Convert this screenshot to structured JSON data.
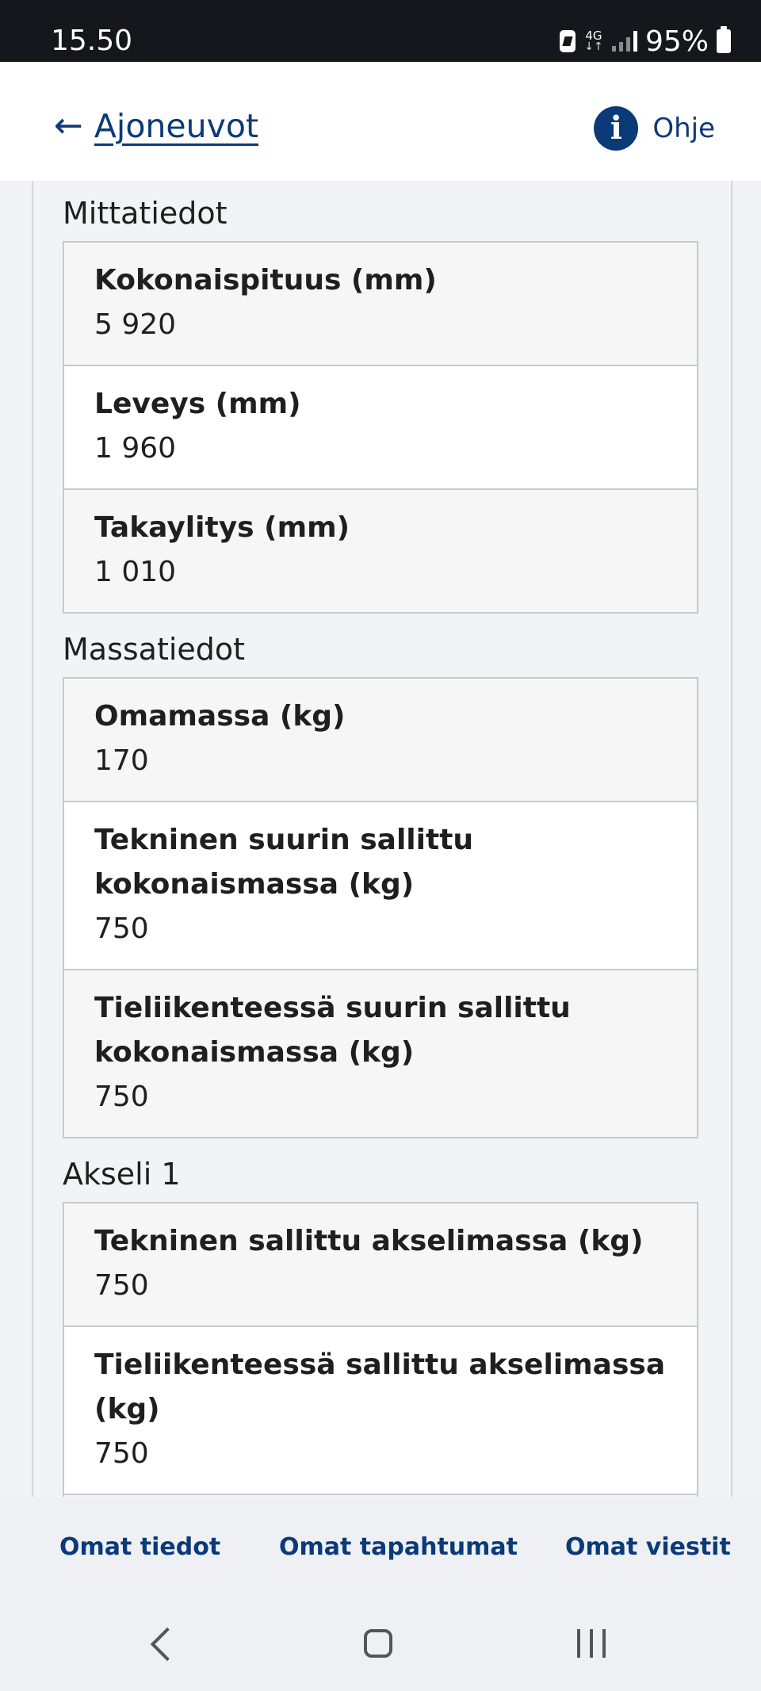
{
  "status_bar": {
    "time": "15.50",
    "network": "4G",
    "battery_percent": "95%"
  },
  "header": {
    "back_label": "Ajoneuvot",
    "help_label": "Ohje",
    "accent_color": "#0b3a78"
  },
  "sections": [
    {
      "title": "Mittatiedot",
      "rows": [
        {
          "label": "Kokonaispituus (mm)",
          "value": "5 920"
        },
        {
          "label": "Leveys (mm)",
          "value": "1 960"
        },
        {
          "label": "Takaylitys (mm)",
          "value": "1 010"
        }
      ]
    },
    {
      "title": "Massatiedot",
      "rows": [
        {
          "label": "Omamassa (kg)",
          "value": "170"
        },
        {
          "label": "Tekninen suurin sallittu kokonaismassa (kg)",
          "value": "750"
        },
        {
          "label": "Tieliikenteessä suurin sallittu kokonaismassa (kg)",
          "value": "750"
        }
      ]
    },
    {
      "title": "Akseli 1",
      "rows": [
        {
          "label": "Tekninen sallittu akselimassa (kg)",
          "value": "750"
        },
        {
          "label": "Tieliikenteessä sallittu akselimassa (kg)",
          "value": "750"
        }
      ]
    }
  ],
  "bottom_nav": {
    "items": [
      "Omat tiedot",
      "Omat tapahtumat",
      "Omat viestit"
    ]
  }
}
